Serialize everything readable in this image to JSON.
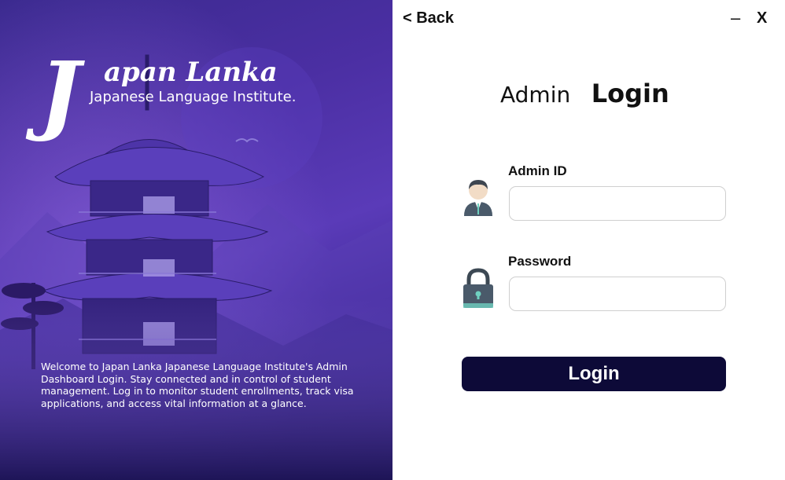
{
  "brand": {
    "name": "apan Lanka",
    "initial": "J",
    "subtitle": "Japanese Language Institute."
  },
  "welcome_text": "Welcome to Japan Lanka Japanese Language Institute's Admin Dashboard Login. Stay connected and in control of student management. Log in to monitor student enrollments, track visa applications, and access vital information at a glance.",
  "nav": {
    "back_label": "< Back"
  },
  "window_controls": {
    "minimize": "–",
    "close": "X"
  },
  "heading": {
    "prefix": "Admin",
    "main": "Login"
  },
  "form": {
    "admin_id_label": "Admin ID",
    "admin_id_value": "",
    "password_label": "Password",
    "password_value": "",
    "submit_label": "Login"
  },
  "icons": {
    "user": "user-avatar-icon",
    "lock": "padlock-icon"
  },
  "colors": {
    "panel_dark": "#221863",
    "panel_mid": "#4b2fa3",
    "button_bg": "#0d0a38",
    "icon_slate": "#4a5a6a",
    "icon_teal": "#6fd0c0"
  }
}
